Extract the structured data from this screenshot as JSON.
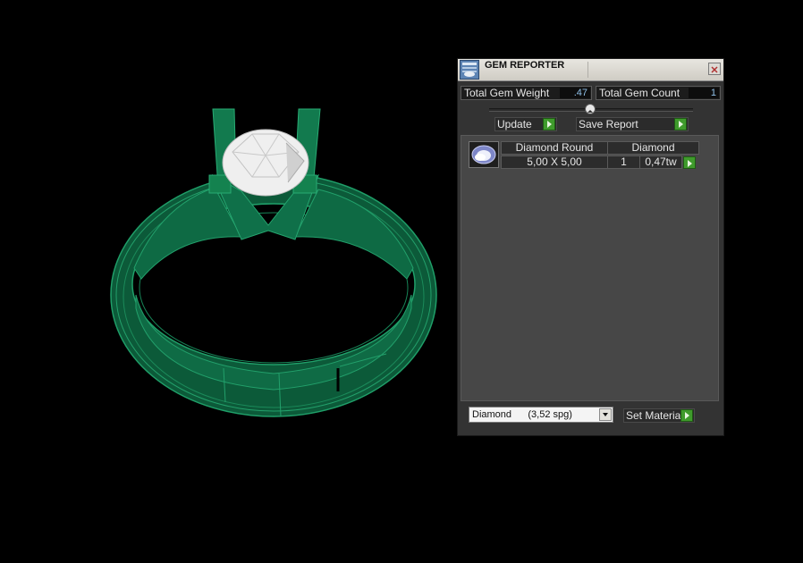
{
  "window": {
    "title": "GEM REPORTER",
    "close_icon": "close-icon",
    "app_icon": "gem-reporter-icon"
  },
  "stats": {
    "total_gem_weight_label": "Total Gem Weight",
    "total_gem_weight_value": ".47",
    "total_gem_count_label": "Total Gem Count",
    "total_gem_count_value": "1"
  },
  "toolbar": {
    "update_label": "Update",
    "save_report_label": "Save Report",
    "go_icon": "play-arrow-icon"
  },
  "gem_list": [
    {
      "thumbnail": "round-gem-icon",
      "name": "Diamond Round",
      "material": "Diamond",
      "size": "5,00 X 5,00",
      "count": "1",
      "weight": "0,47tw"
    }
  ],
  "material_selector": {
    "selected": "Diamond      (3,52 spg)",
    "set_label": "Set Material"
  },
  "colors": {
    "ring_wireframe": "#1a9460",
    "ring_fill": "#0d5e3c",
    "gem": "#f2f2f2",
    "accent_green": "#3f9b2c",
    "value_text": "#8fc0e8"
  }
}
